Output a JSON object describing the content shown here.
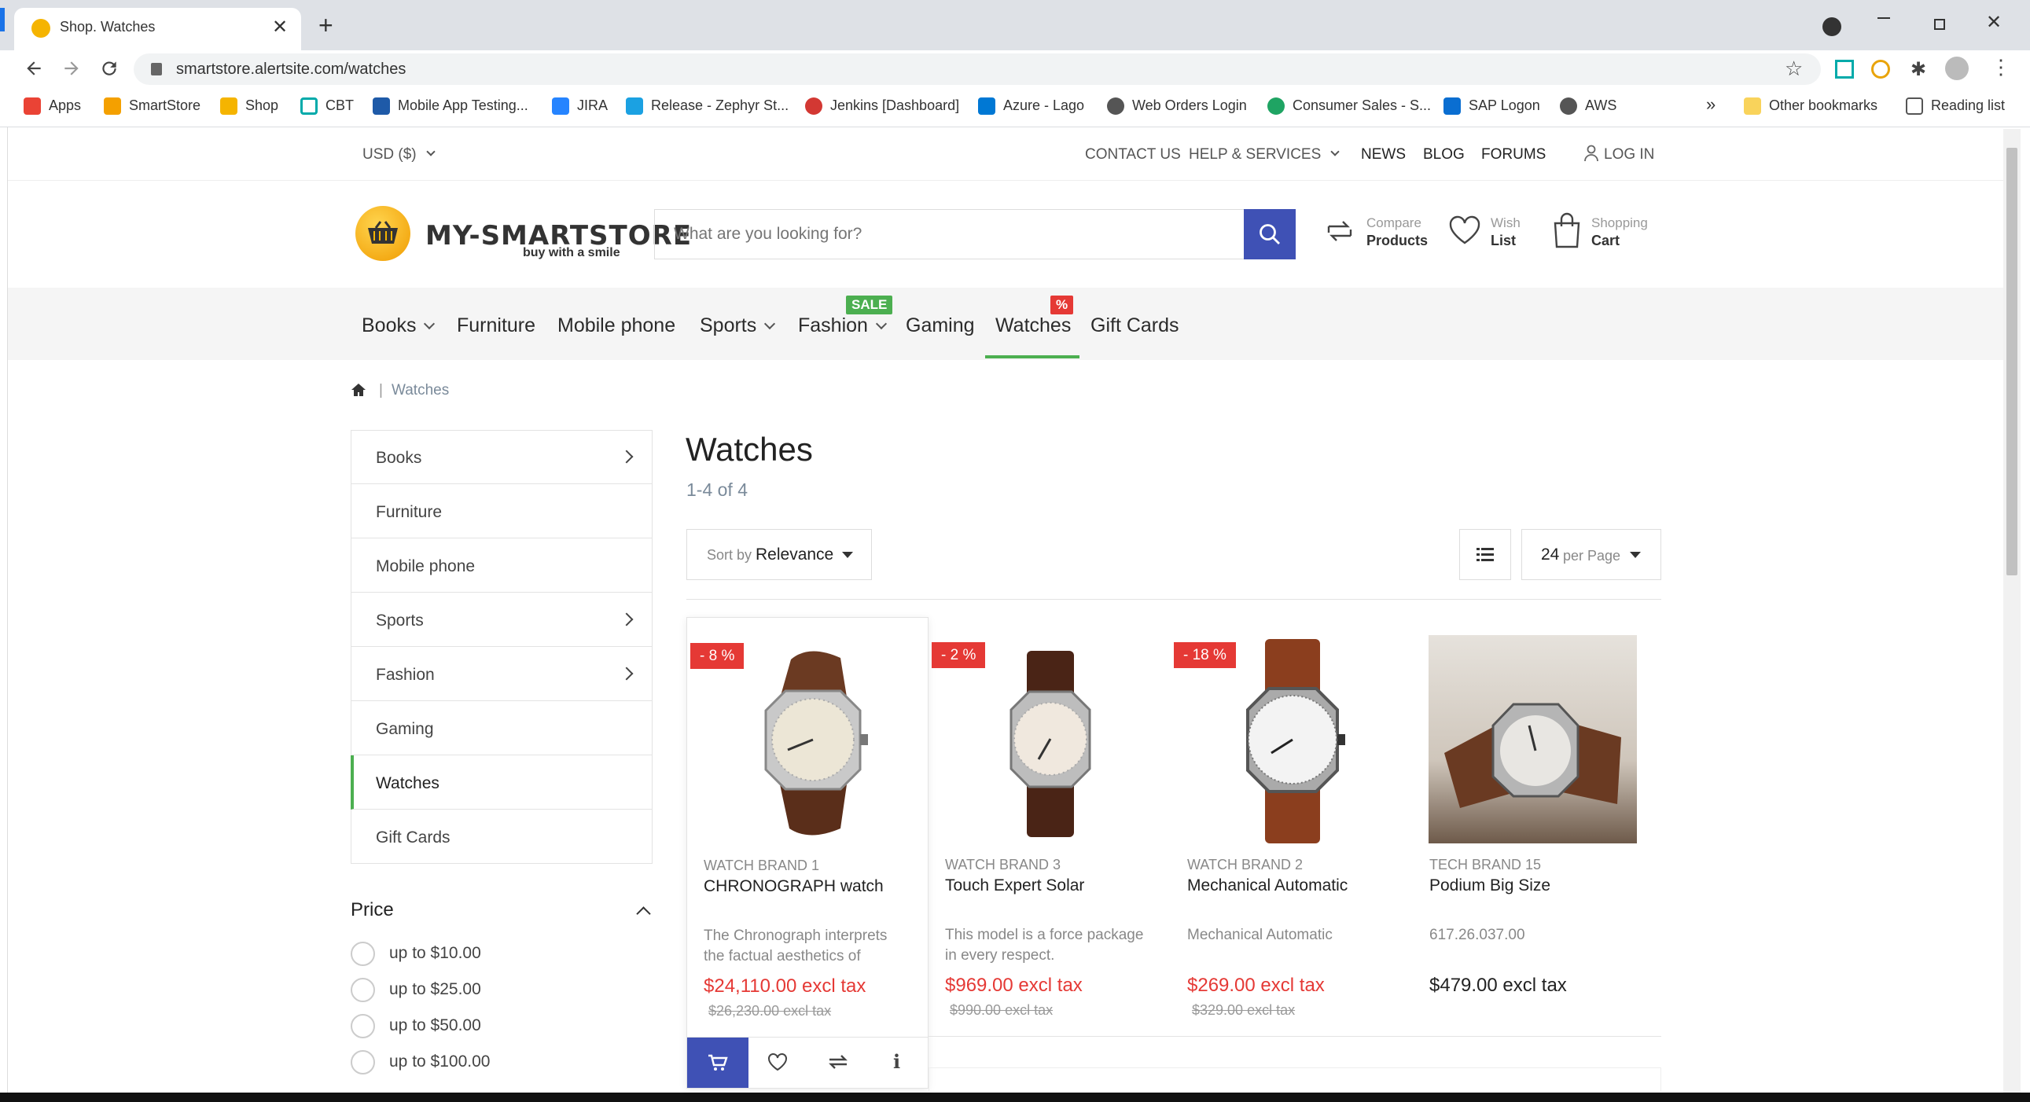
{
  "browser": {
    "tab_title": "Shop. Watches",
    "url": "smartstore.alertsite.com/watches",
    "bookmarks": [
      "Apps",
      "SmartStore",
      "Shop",
      "CBT",
      "Mobile App Testing...",
      "JIRA",
      "Release - Zephyr St...",
      "Jenkins [Dashboard]",
      "Azure - Lago",
      "Web Orders Login",
      "Consumer Sales - S...",
      "SAP Logon",
      "AWS"
    ],
    "overflow": "»",
    "other_bookmarks": "Other bookmarks",
    "reading_list": "Reading list"
  },
  "topbar": {
    "currency": "USD ($)",
    "links": [
      "CONTACT US",
      "HELP & SERVICES"
    ],
    "news": "NEWS",
    "blog": "BLOG",
    "forums": "FORUMS",
    "login": "LOG IN"
  },
  "header": {
    "logo_title": "MY-SMARTSTORE",
    "logo_tagline": "buy with a smile",
    "search_placeholder": "What are you looking for?",
    "compare_top": "Compare",
    "compare_bottom": "Products",
    "wish_top": "Wish",
    "wish_bottom": "List",
    "cart_top": "Shopping",
    "cart_bottom": "Cart"
  },
  "nav": {
    "items": [
      "Books",
      "Furniture",
      "Mobile phone",
      "Sports",
      "Fashion",
      "Gaming",
      "Watches",
      "Gift Cards"
    ],
    "sale_badge": "SALE",
    "percent_badge": "%"
  },
  "breadcrumb": {
    "current": "Watches",
    "separator": "|"
  },
  "sidebar": {
    "categories": [
      "Books",
      "Furniture",
      "Mobile phone",
      "Sports",
      "Fashion",
      "Gaming",
      "Watches",
      "Gift Cards"
    ],
    "price_title": "Price",
    "price_options": [
      "up to $10.00",
      "up to $25.00",
      "up to $50.00",
      "up to $100.00"
    ]
  },
  "listing": {
    "title": "Watches",
    "count": "1-4 of 4",
    "sort_prefix": "Sort by",
    "sort_value": "Relevance",
    "per_page_value": "24",
    "per_page_label": "per Page"
  },
  "products": [
    {
      "badge": "- 8 %",
      "brand": "WATCH BRAND 1",
      "name": "CHRONOGRAPH watch",
      "desc": "The Chronograph interprets the factual aesthetics of",
      "price": "$24,110.00 excl tax",
      "old_price": "$26,230.00 excl tax"
    },
    {
      "badge": "- 2 %",
      "brand": "WATCH BRAND 3",
      "name": "Touch Expert Solar",
      "desc": "This model is a force package in every respect.",
      "price": "$969.00 excl tax",
      "old_price": "$990.00 excl tax"
    },
    {
      "badge": "- 18 %",
      "brand": "WATCH BRAND 2",
      "name": "Mechanical Automatic",
      "desc": "Mechanical Automatic",
      "price": "$269.00 excl tax",
      "old_price": "$329.00 excl tax"
    },
    {
      "badge": "",
      "brand": "TECH BRAND 15",
      "name": "Podium Big Size",
      "desc": "617.26.037.00",
      "price": "$479.00 excl tax",
      "old_price": ""
    }
  ],
  "colors": {
    "accent": "#3f51b5",
    "active": "#4caf50",
    "sale": "#e53935"
  }
}
